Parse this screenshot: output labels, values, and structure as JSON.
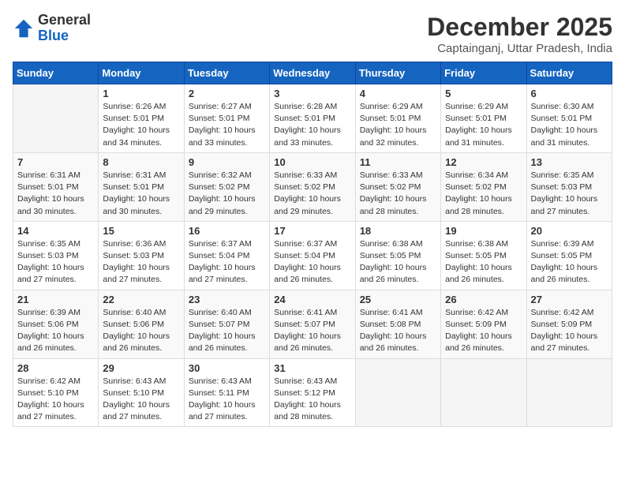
{
  "header": {
    "logo_general": "General",
    "logo_blue": "Blue",
    "month_title": "December 2025",
    "location": "Captainganj, Uttar Pradesh, India"
  },
  "weekdays": [
    "Sunday",
    "Monday",
    "Tuesday",
    "Wednesday",
    "Thursday",
    "Friday",
    "Saturday"
  ],
  "weeks": [
    [
      {
        "day": "",
        "info": ""
      },
      {
        "day": "1",
        "info": "Sunrise: 6:26 AM\nSunset: 5:01 PM\nDaylight: 10 hours\nand 34 minutes."
      },
      {
        "day": "2",
        "info": "Sunrise: 6:27 AM\nSunset: 5:01 PM\nDaylight: 10 hours\nand 33 minutes."
      },
      {
        "day": "3",
        "info": "Sunrise: 6:28 AM\nSunset: 5:01 PM\nDaylight: 10 hours\nand 33 minutes."
      },
      {
        "day": "4",
        "info": "Sunrise: 6:29 AM\nSunset: 5:01 PM\nDaylight: 10 hours\nand 32 minutes."
      },
      {
        "day": "5",
        "info": "Sunrise: 6:29 AM\nSunset: 5:01 PM\nDaylight: 10 hours\nand 31 minutes."
      },
      {
        "day": "6",
        "info": "Sunrise: 6:30 AM\nSunset: 5:01 PM\nDaylight: 10 hours\nand 31 minutes."
      }
    ],
    [
      {
        "day": "7",
        "info": "Sunrise: 6:31 AM\nSunset: 5:01 PM\nDaylight: 10 hours\nand 30 minutes."
      },
      {
        "day": "8",
        "info": "Sunrise: 6:31 AM\nSunset: 5:01 PM\nDaylight: 10 hours\nand 30 minutes."
      },
      {
        "day": "9",
        "info": "Sunrise: 6:32 AM\nSunset: 5:02 PM\nDaylight: 10 hours\nand 29 minutes."
      },
      {
        "day": "10",
        "info": "Sunrise: 6:33 AM\nSunset: 5:02 PM\nDaylight: 10 hours\nand 29 minutes."
      },
      {
        "day": "11",
        "info": "Sunrise: 6:33 AM\nSunset: 5:02 PM\nDaylight: 10 hours\nand 28 minutes."
      },
      {
        "day": "12",
        "info": "Sunrise: 6:34 AM\nSunset: 5:02 PM\nDaylight: 10 hours\nand 28 minutes."
      },
      {
        "day": "13",
        "info": "Sunrise: 6:35 AM\nSunset: 5:03 PM\nDaylight: 10 hours\nand 27 minutes."
      }
    ],
    [
      {
        "day": "14",
        "info": "Sunrise: 6:35 AM\nSunset: 5:03 PM\nDaylight: 10 hours\nand 27 minutes."
      },
      {
        "day": "15",
        "info": "Sunrise: 6:36 AM\nSunset: 5:03 PM\nDaylight: 10 hours\nand 27 minutes."
      },
      {
        "day": "16",
        "info": "Sunrise: 6:37 AM\nSunset: 5:04 PM\nDaylight: 10 hours\nand 27 minutes."
      },
      {
        "day": "17",
        "info": "Sunrise: 6:37 AM\nSunset: 5:04 PM\nDaylight: 10 hours\nand 26 minutes."
      },
      {
        "day": "18",
        "info": "Sunrise: 6:38 AM\nSunset: 5:05 PM\nDaylight: 10 hours\nand 26 minutes."
      },
      {
        "day": "19",
        "info": "Sunrise: 6:38 AM\nSunset: 5:05 PM\nDaylight: 10 hours\nand 26 minutes."
      },
      {
        "day": "20",
        "info": "Sunrise: 6:39 AM\nSunset: 5:05 PM\nDaylight: 10 hours\nand 26 minutes."
      }
    ],
    [
      {
        "day": "21",
        "info": "Sunrise: 6:39 AM\nSunset: 5:06 PM\nDaylight: 10 hours\nand 26 minutes."
      },
      {
        "day": "22",
        "info": "Sunrise: 6:40 AM\nSunset: 5:06 PM\nDaylight: 10 hours\nand 26 minutes."
      },
      {
        "day": "23",
        "info": "Sunrise: 6:40 AM\nSunset: 5:07 PM\nDaylight: 10 hours\nand 26 minutes."
      },
      {
        "day": "24",
        "info": "Sunrise: 6:41 AM\nSunset: 5:07 PM\nDaylight: 10 hours\nand 26 minutes."
      },
      {
        "day": "25",
        "info": "Sunrise: 6:41 AM\nSunset: 5:08 PM\nDaylight: 10 hours\nand 26 minutes."
      },
      {
        "day": "26",
        "info": "Sunrise: 6:42 AM\nSunset: 5:09 PM\nDaylight: 10 hours\nand 26 minutes."
      },
      {
        "day": "27",
        "info": "Sunrise: 6:42 AM\nSunset: 5:09 PM\nDaylight: 10 hours\nand 27 minutes."
      }
    ],
    [
      {
        "day": "28",
        "info": "Sunrise: 6:42 AM\nSunset: 5:10 PM\nDaylight: 10 hours\nand 27 minutes."
      },
      {
        "day": "29",
        "info": "Sunrise: 6:43 AM\nSunset: 5:10 PM\nDaylight: 10 hours\nand 27 minutes."
      },
      {
        "day": "30",
        "info": "Sunrise: 6:43 AM\nSunset: 5:11 PM\nDaylight: 10 hours\nand 27 minutes."
      },
      {
        "day": "31",
        "info": "Sunrise: 6:43 AM\nSunset: 5:12 PM\nDaylight: 10 hours\nand 28 minutes."
      },
      {
        "day": "",
        "info": ""
      },
      {
        "day": "",
        "info": ""
      },
      {
        "day": "",
        "info": ""
      }
    ]
  ]
}
